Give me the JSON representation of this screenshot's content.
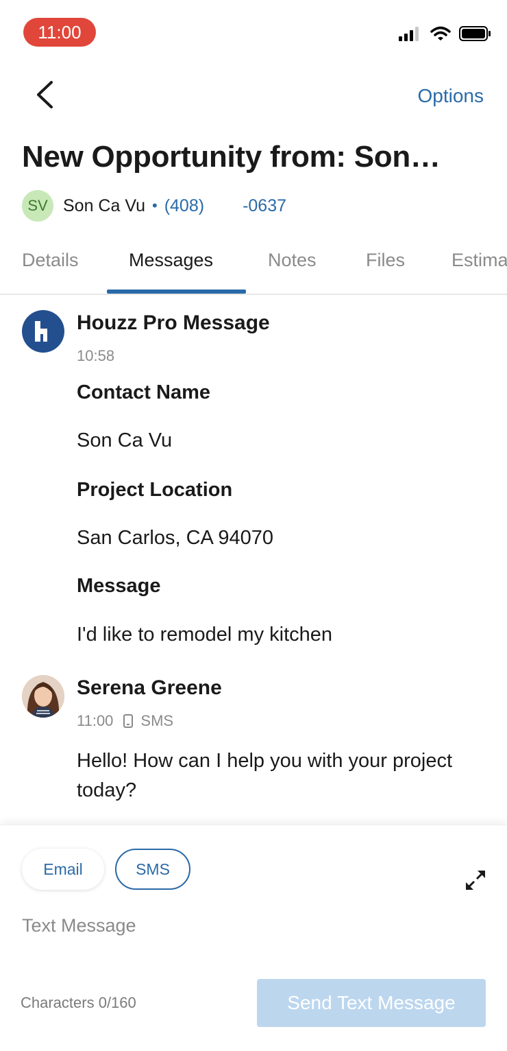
{
  "status_bar": {
    "time": "11:00",
    "icons": [
      "signal-icon",
      "wifi-icon",
      "battery-icon"
    ]
  },
  "header": {
    "back_icon": "chevron-left-icon",
    "options_label": "Options",
    "title": "New Opportunity from: Son…"
  },
  "contact": {
    "initials": "SV",
    "name": "Son Ca Vu",
    "separator": "•",
    "phone_area": "(408)",
    "phone_suffix": "-0637"
  },
  "tabs": [
    {
      "label": "Details",
      "active": false
    },
    {
      "label": "Messages",
      "active": true
    },
    {
      "label": "Notes",
      "active": false
    },
    {
      "label": "Files",
      "active": false
    },
    {
      "label": "Estima",
      "active": false
    }
  ],
  "messages": [
    {
      "sender": "Houzz Pro Message",
      "time": "10:58",
      "fields": [
        {
          "label": "Contact Name",
          "value": "Son Ca Vu"
        },
        {
          "label": "Project Location",
          "value": "San Carlos, CA 94070"
        },
        {
          "label": "Message",
          "value": "I'd like to remodel my kitchen"
        }
      ]
    },
    {
      "sender": "Serena Greene",
      "time": "11:00",
      "channel": "SMS",
      "channel_icon": "phone-icon",
      "text": "Hello! How can I help you with your project today?"
    }
  ],
  "composer": {
    "email_label": "Email",
    "sms_label": "SMS",
    "selected_channel": "SMS",
    "expand_icon": "expand-icon",
    "placeholder": "Text Message",
    "char_count": "Characters 0/160",
    "send_label": "Send Text Message"
  },
  "colors": {
    "accent": "#2a6aa8",
    "time_pill": "#e0473a",
    "send_disabled": "#bcd6ee",
    "houzz_logo": "#234f8f"
  }
}
